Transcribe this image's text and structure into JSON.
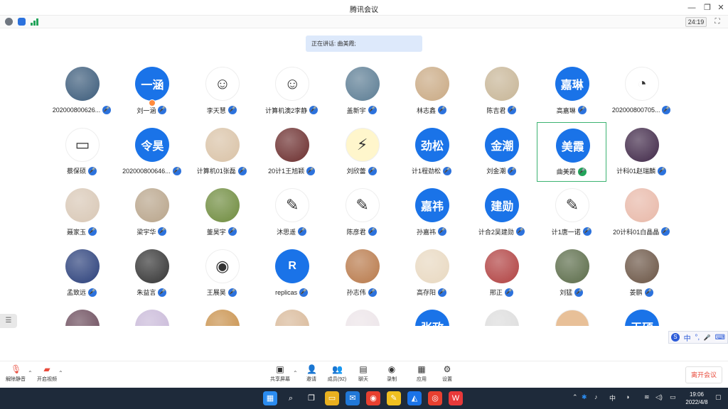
{
  "window": {
    "title": "腾讯会议",
    "minimize": "—",
    "restore": "❐",
    "close": "✕"
  },
  "infobar": {
    "timer": "24:19",
    "icons": [
      "info-icon",
      "shield-icon",
      "signal-icon"
    ]
  },
  "speaking_label": "正在讲话: 曲美霞;",
  "participants": [
    {
      "name": "2020008006​26...",
      "avatar": "night-sky",
      "avatar_text": "",
      "color": "#3b5b7a"
    },
    {
      "name": "刘一涵",
      "avatar": "text",
      "avatar_text": "一涵",
      "color": "#1a73e8",
      "badge": true
    },
    {
      "name": "李天慧",
      "avatar": "cartoon",
      "avatar_text": "☺",
      "color": "#ffffff"
    },
    {
      "name": "计算机澳2李静",
      "avatar": "cartoon",
      "avatar_text": "☺",
      "color": "#ffffff"
    },
    {
      "name": "盖新宇",
      "avatar": "photo",
      "avatar_text": "",
      "color": "#5b7c93"
    },
    {
      "name": "林志鑫",
      "avatar": "dog",
      "avatar_text": "",
      "color": "#c9a983"
    },
    {
      "name": "陈吉君",
      "avatar": "anime",
      "avatar_text": "",
      "color": "#c7b596"
    },
    {
      "name": "高嘉琳",
      "avatar": "text",
      "avatar_text": "嘉琳",
      "color": "#1a73e8"
    },
    {
      "name": "202000800705...",
      "avatar": "cartoon",
      "avatar_text": "◔",
      "color": "#ffffff"
    },
    {
      "name": "蔡保硕",
      "avatar": "cartoon",
      "avatar_text": "▭",
      "color": "#ffffff"
    },
    {
      "name": "202000800646...",
      "avatar": "text",
      "avatar_text": "令昊",
      "color": "#1a73e8"
    },
    {
      "name": "计算机01张磊",
      "avatar": "anime",
      "avatar_text": "",
      "color": "#d9c2a6"
    },
    {
      "name": "20计1王旭颖",
      "avatar": "photo",
      "avatar_text": "",
      "color": "#6b2d2d"
    },
    {
      "name": "刘欣蕾",
      "avatar": "cartoon",
      "avatar_text": "⚡",
      "color": "#fff6cc"
    },
    {
      "name": "计1程劲松",
      "avatar": "text",
      "avatar_text": "劲松",
      "color": "#1a73e8"
    },
    {
      "name": "刘金潮",
      "avatar": "text",
      "avatar_text": "金潮",
      "color": "#1a73e8"
    },
    {
      "name": "曲美霞",
      "avatar": "text",
      "avatar_text": "美霞",
      "color": "#1a73e8",
      "active": true
    },
    {
      "name": "计科01赵瑞麟",
      "avatar": "night-sky",
      "avatar_text": "",
      "color": "#402848"
    },
    {
      "name": "聂家玉",
      "avatar": "cat",
      "avatar_text": "",
      "color": "#d8c7b5"
    },
    {
      "name": "梁宇华",
      "avatar": "photo",
      "avatar_text": "",
      "color": "#b8a48a"
    },
    {
      "name": "董昊宇",
      "avatar": "photo",
      "avatar_text": "",
      "color": "#6e8b3d"
    },
    {
      "name": "沐思遥",
      "avatar": "cartoon",
      "avatar_text": "✎",
      "color": "#ffffff"
    },
    {
      "name": "陈彦君",
      "avatar": "cartoon",
      "avatar_text": "✎",
      "color": "#ffffff"
    },
    {
      "name": "孙嘉祎",
      "avatar": "text",
      "avatar_text": "嘉祎",
      "color": "#1a73e8"
    },
    {
      "name": "计合2吴建勋",
      "avatar": "text",
      "avatar_text": "建勋",
      "color": "#1a73e8"
    },
    {
      "name": "计1唐一诺",
      "avatar": "cartoon",
      "avatar_text": "✎",
      "color": "#ffffff"
    },
    {
      "name": "20计科01白晶晶",
      "avatar": "anime",
      "avatar_text": "",
      "color": "#e8b8a8"
    },
    {
      "name": "孟致远",
      "avatar": "photo",
      "avatar_text": "",
      "color": "#2a3f7a"
    },
    {
      "name": "朱益言",
      "avatar": "photo",
      "avatar_text": "",
      "color": "#333333"
    },
    {
      "name": "王展昊",
      "avatar": "cartoon",
      "avatar_text": "◉",
      "color": "#ffffff"
    },
    {
      "name": "replicas",
      "avatar": "text",
      "avatar_text": "R",
      "color": "#1a73e8"
    },
    {
      "name": "孙志伟",
      "avatar": "photo",
      "avatar_text": "",
      "color": "#b8794a"
    },
    {
      "name": "高存阳",
      "avatar": "anime",
      "avatar_text": "",
      "color": "#e8d8c0"
    },
    {
      "name": "邢正",
      "avatar": "anime",
      "avatar_text": "",
      "color": "#b04040"
    },
    {
      "name": "刘猛",
      "avatar": "photo",
      "avatar_text": "",
      "color": "#5a6b48"
    },
    {
      "name": "姜鹏",
      "avatar": "dog",
      "avatar_text": "",
      "color": "#6a5444"
    },
    {
      "name": "",
      "avatar": "anime",
      "avatar_text": "",
      "color": "#6a4a5a"
    },
    {
      "name": "",
      "avatar": "anime",
      "avatar_text": "",
      "color": "#c8b8d8"
    },
    {
      "name": "",
      "avatar": "dog",
      "avatar_text": "",
      "color": "#c8904a"
    },
    {
      "name": "",
      "avatar": "dog",
      "avatar_text": "",
      "color": "#d8b898"
    },
    {
      "name": "",
      "avatar": "anime",
      "avatar_text": "",
      "color": "#ece4e8"
    },
    {
      "name": "",
      "avatar": "text",
      "avatar_text": "张政",
      "color": "#1a73e8"
    },
    {
      "name": "",
      "avatar": "cat",
      "avatar_text": "",
      "color": "#dcdcdc"
    },
    {
      "name": "",
      "avatar": "cartoon",
      "avatar_text": "",
      "color": "#e8c098"
    },
    {
      "name": "",
      "avatar": "text",
      "avatar_text": "王硕",
      "color": "#1a73e8"
    }
  ],
  "ime": {
    "items": [
      "中",
      "°,",
      "🎤",
      "⌨"
    ],
    "logo": "S"
  },
  "controls": {
    "unmute": "解除静音",
    "start_video": "开启视频",
    "share_screen": "共享屏幕",
    "invite": "邀请",
    "members": "成员(92)",
    "chat": "聊天",
    "record": "录制",
    "apps": "应用",
    "settings": "设置",
    "leave": "离开会议"
  },
  "taskbar": {
    "apps": [
      {
        "name": "start-icon",
        "glyph": "▦",
        "color": "#2b8cf0"
      },
      {
        "name": "search-icon",
        "glyph": "⌕",
        "color": "#1e2a3a"
      },
      {
        "name": "task-view-icon",
        "glyph": "❐",
        "color": "#1e2a3a"
      },
      {
        "name": "folder-icon",
        "glyph": "▭",
        "color": "#e8b020"
      },
      {
        "name": "mail-icon",
        "glyph": "✉",
        "color": "#2078d8"
      },
      {
        "name": "chrome-icon",
        "glyph": "◉",
        "color": "#e84030"
      },
      {
        "name": "notes-icon",
        "glyph": "✎",
        "color": "#f0c020"
      },
      {
        "name": "meeting-icon",
        "glyph": "◭",
        "color": "#1a73e8"
      },
      {
        "name": "app-icon",
        "glyph": "◎",
        "color": "#e84030"
      },
      {
        "name": "wps-icon",
        "glyph": "W",
        "color": "#e8393a"
      }
    ],
    "tray_lang": "中",
    "time": "19:06",
    "date": "2022/4/8"
  }
}
